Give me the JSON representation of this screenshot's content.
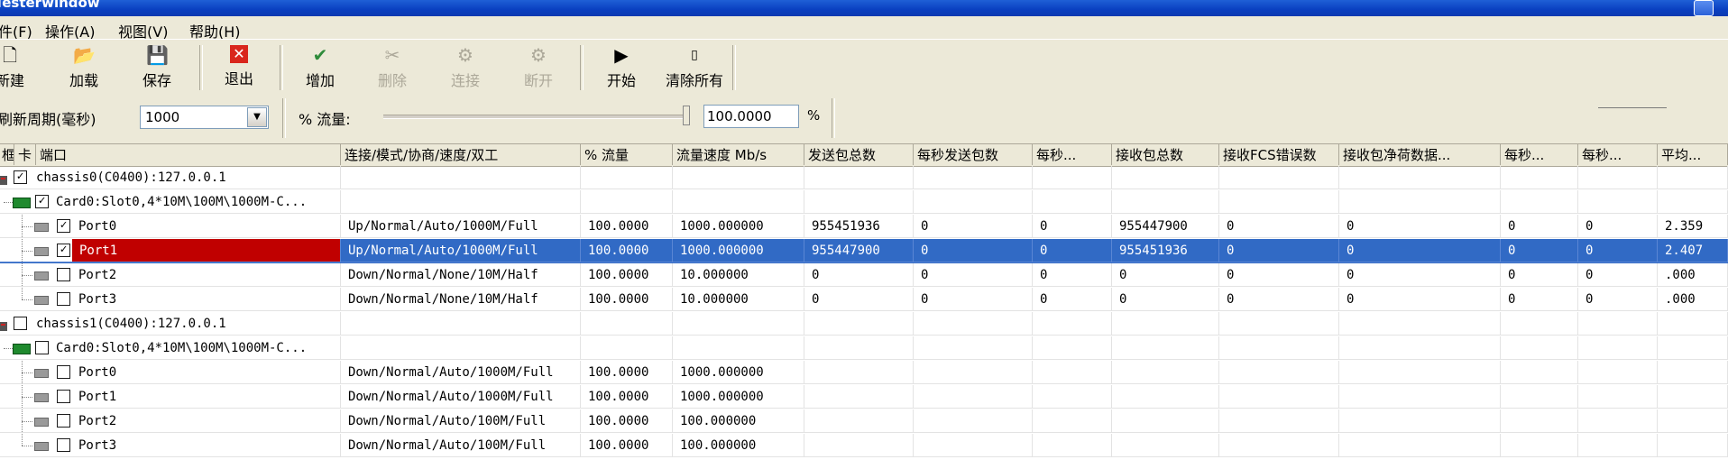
{
  "window": {
    "title": "Testerwindow"
  },
  "menu": [
    "件(F)",
    "操作(A)",
    "视图(V)",
    "帮助(H)"
  ],
  "toolbar": {
    "buttons": [
      {
        "label": "新建",
        "icon": "new-file-icon",
        "enabled": true
      },
      {
        "label": "加载",
        "icon": "open-folder-icon",
        "enabled": true
      },
      {
        "label": "保存",
        "icon": "save-icon",
        "enabled": true
      },
      {
        "label": "退出",
        "icon": "exit-icon",
        "enabled": true
      },
      {
        "label": "增加",
        "icon": "add-icon",
        "enabled": true
      },
      {
        "label": "删除",
        "icon": "delete-icon",
        "enabled": false
      },
      {
        "label": "连接",
        "icon": "connect-icon",
        "enabled": false
      },
      {
        "label": "断开",
        "icon": "disconnect-icon",
        "enabled": false
      },
      {
        "label": "开始",
        "icon": "play-icon",
        "enabled": true
      },
      {
        "label": "清除所有",
        "icon": "clear-icon",
        "enabled": true
      }
    ]
  },
  "controls": {
    "refresh_label": "刷新周期(毫秒)",
    "refresh_value": "1000",
    "traffic_label": "% 流量:",
    "traffic_value": "100.0000",
    "traffic_unit": "%",
    "traffic_level": 1.0
  },
  "grid": {
    "columns": [
      "框",
      "卡",
      "端口",
      "连接/模式/协商/速度/双工",
      "% 流量",
      "流量速度 Mb/s",
      "发送包总数",
      "每秒发送包数",
      "每秒...",
      "接收包总数",
      "接收FCS错误数",
      "接收包净荷数据...",
      "每秒...",
      "每秒...",
      "平均..."
    ],
    "chassis": [
      {
        "label": "chassis0(C0400):127.0.0.1",
        "checked": true,
        "card": {
          "label": "Card0:Slot0,4*10M\\100M\\1000M-C...",
          "checked": true
        },
        "ports": [
          {
            "name": "Port0",
            "checked": true,
            "selected": false,
            "link": "Up/Normal/Auto/1000M/Full",
            "pct": "100.0000",
            "speed": "1000.000000",
            "tx": "955451936",
            "txps": "0",
            "c8": "0",
            "rx": "955447900",
            "fcs": "0",
            "payload": "0",
            "c12": "0",
            "c13": "0",
            "avg": "2.359"
          },
          {
            "name": "Port1",
            "checked": true,
            "selected": true,
            "link": "Up/Normal/Auto/1000M/Full",
            "pct": "100.0000",
            "speed": "1000.000000",
            "tx": "955447900",
            "txps": "0",
            "c8": "0",
            "rx": "955451936",
            "fcs": "0",
            "payload": "0",
            "c12": "0",
            "c13": "0",
            "avg": "2.407"
          },
          {
            "name": "Port2",
            "checked": false,
            "selected": false,
            "link": "Down/Normal/None/10M/Half",
            "pct": "100.0000",
            "speed": "10.000000",
            "tx": "0",
            "txps": "0",
            "c8": "0",
            "rx": "0",
            "fcs": "0",
            "payload": "0",
            "c12": "0",
            "c13": "0",
            "avg": ".000"
          },
          {
            "name": "Port3",
            "checked": false,
            "selected": false,
            "link": "Down/Normal/None/10M/Half",
            "pct": "100.0000",
            "speed": "10.000000",
            "tx": "0",
            "txps": "0",
            "c8": "0",
            "rx": "0",
            "fcs": "0",
            "payload": "0",
            "c12": "0",
            "c13": "0",
            "avg": ".000"
          }
        ]
      },
      {
        "label": "chassis1(C0400):127.0.0.1",
        "checked": false,
        "card": {
          "label": "Card0:Slot0,4*10M\\100M\\1000M-C...",
          "checked": false
        },
        "ports": [
          {
            "name": "Port0",
            "checked": false,
            "selected": false,
            "link": "Down/Normal/Auto/1000M/Full",
            "pct": "100.0000",
            "speed": "1000.000000",
            "tx": "",
            "txps": "",
            "c8": "",
            "rx": "",
            "fcs": "",
            "payload": "",
            "c12": "",
            "c13": "",
            "avg": ""
          },
          {
            "name": "Port1",
            "checked": false,
            "selected": false,
            "link": "Down/Normal/Auto/1000M/Full",
            "pct": "100.0000",
            "speed": "1000.000000",
            "tx": "",
            "txps": "",
            "c8": "",
            "rx": "",
            "fcs": "",
            "payload": "",
            "c12": "",
            "c13": "",
            "avg": ""
          },
          {
            "name": "Port2",
            "checked": false,
            "selected": false,
            "link": "Down/Normal/Auto/100M/Full",
            "pct": "100.0000",
            "speed": "100.000000",
            "tx": "",
            "txps": "",
            "c8": "",
            "rx": "",
            "fcs": "",
            "payload": "",
            "c12": "",
            "c13": "",
            "avg": ""
          },
          {
            "name": "Port3",
            "checked": false,
            "selected": false,
            "link": "Down/Normal/Auto/100M/Full",
            "pct": "100.0000",
            "speed": "100.000000",
            "tx": "",
            "txps": "",
            "c8": "",
            "rx": "",
            "fcs": "",
            "payload": "",
            "c12": "",
            "c13": "",
            "avg": ""
          }
        ]
      }
    ]
  },
  "colors": {
    "selection": "#316ac5",
    "highlight_red": "#c00000",
    "titlebar": "#0a3fc0"
  }
}
